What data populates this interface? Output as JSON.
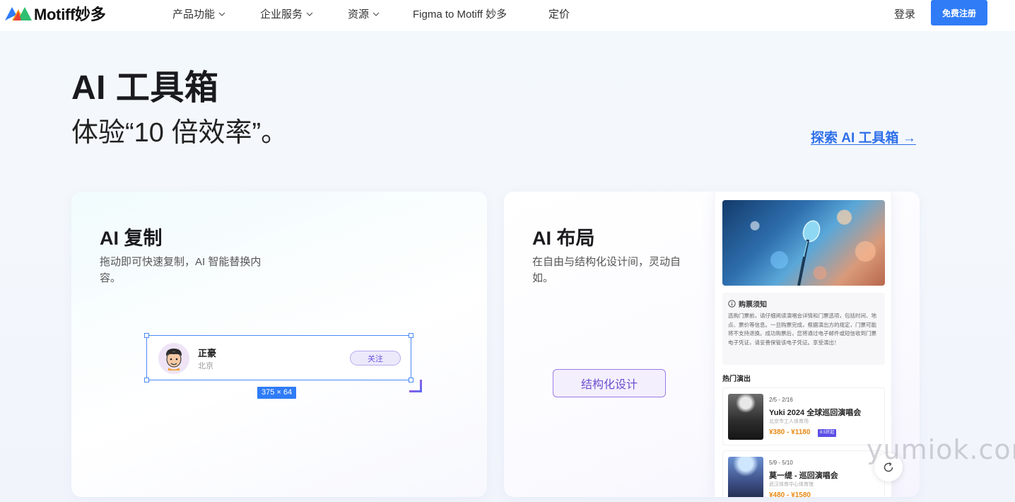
{
  "header": {
    "brand": "Motiff妙多",
    "nav": [
      {
        "label": "产品功能",
        "has_dropdown": true
      },
      {
        "label": "企业服务",
        "has_dropdown": true
      },
      {
        "label": "资源",
        "has_dropdown": true
      },
      {
        "label": "Figma to Motiff 妙多",
        "has_dropdown": false
      },
      {
        "label": "定价",
        "has_dropdown": false
      }
    ],
    "login_label": "登录",
    "signup_label": "免费注册",
    "accent": "#2f7cf6"
  },
  "hero": {
    "title": "AI 工具箱",
    "subtitle": "体验“10 倍效率”。",
    "explore_link": "探索 AI 工具箱 →"
  },
  "cards": {
    "copy": {
      "title": "AI 复制",
      "desc": "拖动即可快速复制，AI 智能替换内容。",
      "person_name": "正豪",
      "person_city": "北京",
      "follow_label": "关注",
      "dimension_label": "375 × 64"
    },
    "layout": {
      "title": "AI 布局",
      "desc": "在自由与结构化设计间，灵动自如。",
      "button_label": "结构化设计",
      "notice_title": "购票须知",
      "notice_body": "选购门票前，请仔细阅读演唱会详情和门票选项，包括时间、地点、票价等信息。一旦购票完成，根据演出方的规定，门票可能将不支持退换。成功购票后，您将通过电子邮件或短信收到门票电子凭证，请妥善保管该电子凭证。享受演出！",
      "hot_title": "热门演出",
      "events": [
        {
          "date": "2/5 - 2/16",
          "name": "Yuki 2024 全球巡回演唱会",
          "venue": "北京市工人体育场",
          "price": "¥380 - ¥1180",
          "badge": "8.5折起"
        },
        {
          "date": "5/9 - 5/10",
          "name": "莫一缇 - 巡回演唱会",
          "venue": "武汉体育中心体育馆",
          "price": "¥480 - ¥1580",
          "badge": ""
        }
      ]
    }
  },
  "watermark": "yumiok.com"
}
